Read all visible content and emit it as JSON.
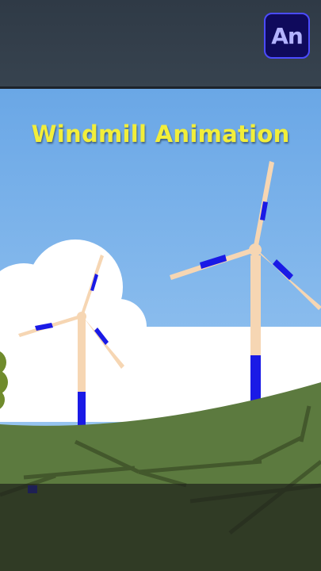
{
  "app": {
    "badge_label": "An",
    "badge_icon": "adobe-animate-icon",
    "badge_color": "#0f0a5c"
  },
  "stage": {
    "title": "Windmill Animation",
    "sky_color": "#7fb6ea",
    "hill_color": "#5c7a3f",
    "cloud_color": "#ffffff",
    "turbine_color": "#f6d6b3",
    "turbine_accent": "#1a1ae6"
  }
}
